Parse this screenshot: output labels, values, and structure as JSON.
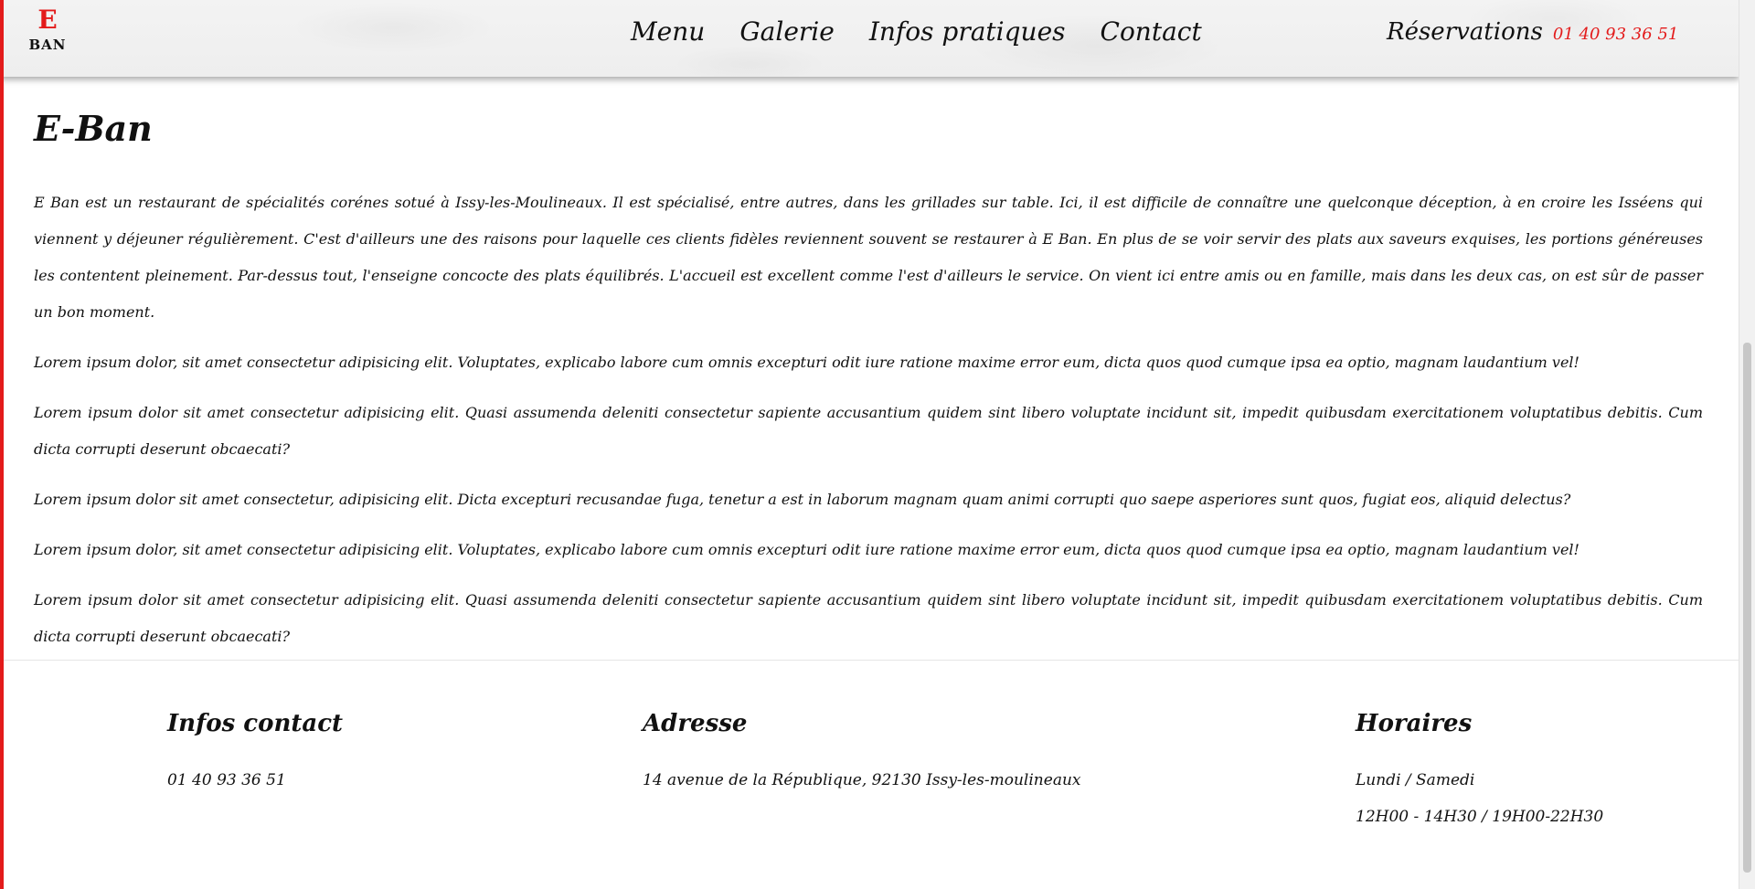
{
  "header": {
    "logo": {
      "mark": "E",
      "word": "BAN"
    },
    "nav": [
      "Menu",
      "Galerie",
      "Infos pratiques",
      "Contact"
    ],
    "reservations": {
      "label": "Réservations",
      "phone": "01 40 93 36 51"
    }
  },
  "main": {
    "title": "E-Ban",
    "paragraphs": [
      "E Ban est un restaurant de spécialités corénes sotué à Issy-les-Moulineaux. Il est spécialisé, entre autres, dans les grillades sur table. Ici, il est difficile de connaître une quelconque déception, à en croire les Isséens qui viennent y déjeuner régulièrement. C'est d'ailleurs une des raisons pour laquelle ces clients fidèles reviennent souvent se restaurer à E Ban. En plus de se voir servir des plats aux saveurs exquises, les portions généreuses les contentent pleinement. Par-dessus tout, l'enseigne concocte des plats équilibrés. L'accueil est excellent comme l'est d'ailleurs le service. On vient ici entre amis ou en famille, mais dans les deux cas, on est sûr de passer un bon moment.",
      "Lorem ipsum dolor, sit amet consectetur adipisicing elit. Voluptates, explicabo labore cum omnis excepturi odit iure ratione maxime error eum, dicta quos quod cumque ipsa ea optio, magnam laudantium vel!",
      "Lorem ipsum dolor sit amet consectetur adipisicing elit. Quasi assumenda deleniti consectetur sapiente accusantium quidem sint libero voluptate incidunt sit, impedit quibusdam exercitationem voluptatibus debitis. Cum dicta corrupti deserunt obcaecati?",
      "Lorem ipsum dolor sit amet consectetur, adipisicing elit. Dicta excepturi recusandae fuga, tenetur a est in laborum magnam quam animi corrupti quo saepe asperiores sunt quos, fugiat eos, aliquid delectus?",
      "Lorem ipsum dolor, sit amet consectetur adipisicing elit. Voluptates, explicabo labore cum omnis excepturi odit iure ratione maxime error eum, dicta quos quod cumque ipsa ea optio, magnam laudantium vel!",
      "Lorem ipsum dolor sit amet consectetur adipisicing elit. Quasi assumenda deleniti consectetur sapiente accusantium quidem sint libero voluptate incidunt sit, impedit quibusdam exercitationem voluptatibus debitis. Cum dicta corrupti deserunt obcaecati?"
    ]
  },
  "footer": {
    "contact": {
      "title": "Infos contact",
      "phone": "01 40 93 36 51"
    },
    "address": {
      "title": "Adresse",
      "text": "14 avenue de la République, 92130 Issy-les-moulineaux"
    },
    "hours": {
      "title": "Horaires",
      "days": "Lundi / Samedi",
      "times": "12H00 - 14H30 / 19H00-22H30"
    }
  },
  "colors": {
    "accent": "#e31b1b",
    "text": "#111111",
    "header_bg": "#f0f0f0"
  }
}
